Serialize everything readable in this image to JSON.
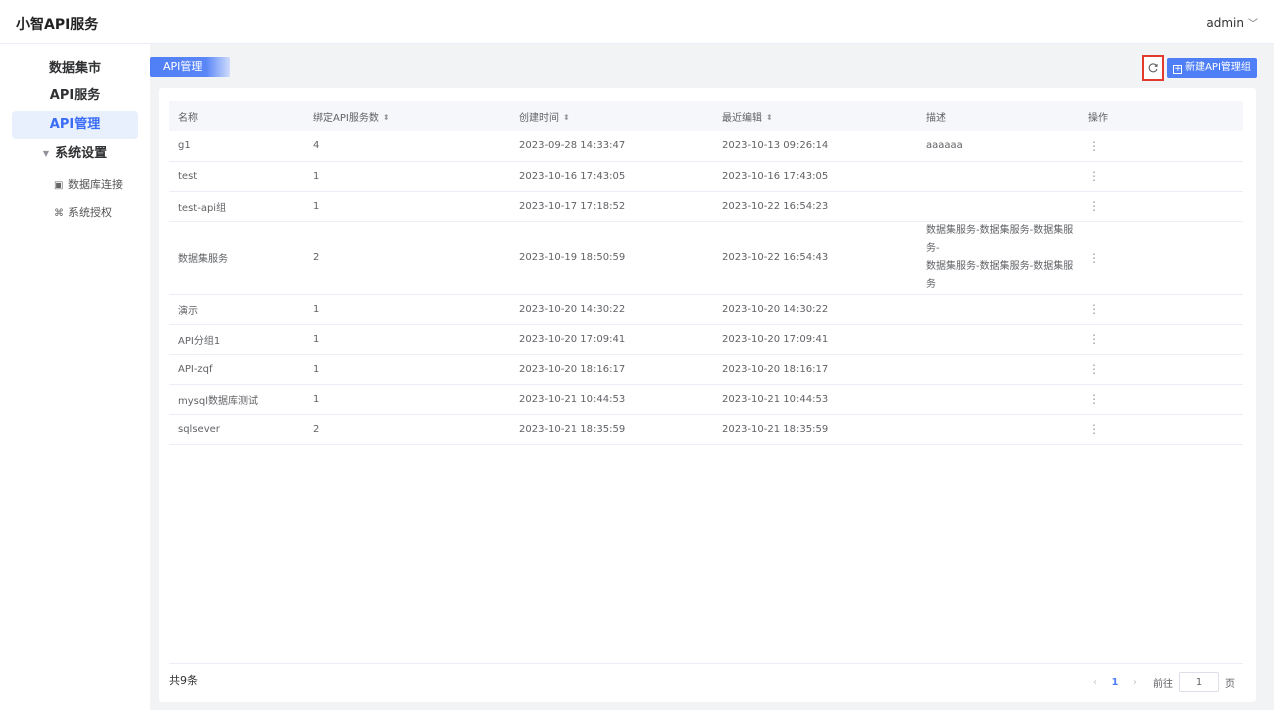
{
  "header": {
    "app_title": "小智API服务",
    "user": "admin"
  },
  "sidebar": {
    "items": [
      {
        "label": "数据集市"
      },
      {
        "label": "API服务"
      },
      {
        "label": "API管理"
      }
    ],
    "group": {
      "label": "系统设置"
    },
    "sub_items": [
      {
        "label": "数据库连接",
        "icon": "database-icon"
      },
      {
        "label": "系统授权",
        "icon": "auth-icon"
      }
    ]
  },
  "breadcrumb": {
    "label": "API管理"
  },
  "toolbar": {
    "new_label": "新建API管理组",
    "refresh_icon": "refresh-icon"
  },
  "table": {
    "columns": [
      "名称",
      "绑定API服务数",
      "创建时间",
      "最近编辑",
      "描述",
      "操作"
    ],
    "rows": [
      {
        "name": "g1",
        "count": "4",
        "created": "2023-09-28 14:33:47",
        "edited": "2023-10-13 09:26:14",
        "desc": "aaaaaa"
      },
      {
        "name": "test",
        "count": "1",
        "created": "2023-10-16 17:43:05",
        "edited": "2023-10-16 17:43:05",
        "desc": ""
      },
      {
        "name": "test-api组",
        "count": "1",
        "created": "2023-10-17 17:18:52",
        "edited": "2023-10-22 16:54:23",
        "desc": ""
      },
      {
        "name": "数据集服务",
        "count": "2",
        "created": "2023-10-19 18:50:59",
        "edited": "2023-10-22 16:54:43",
        "desc": "数据集服务-数据集服务-数据集服务-",
        "desc2": "数据集服务-数据集服务-数据集服务"
      },
      {
        "name": "演示",
        "count": "1",
        "created": "2023-10-20 14:30:22",
        "edited": "2023-10-20 14:30:22",
        "desc": ""
      },
      {
        "name": "API分组1",
        "count": "1",
        "created": "2023-10-20 17:09:41",
        "edited": "2023-10-20 17:09:41",
        "desc": ""
      },
      {
        "name": "API-zqf",
        "count": "1",
        "created": "2023-10-20 18:16:17",
        "edited": "2023-10-20 18:16:17",
        "desc": ""
      },
      {
        "name": "mysql数据库测试",
        "count": "1",
        "created": "2023-10-21 10:44:53",
        "edited": "2023-10-21 10:44:53",
        "desc": ""
      },
      {
        "name": "sqlsever",
        "count": "2",
        "created": "2023-10-21 18:35:59",
        "edited": "2023-10-21 18:35:59",
        "desc": ""
      }
    ],
    "op_glyph": "⋮"
  },
  "footer": {
    "total": "共9条",
    "current_page": "1",
    "goto_label": "前往",
    "goto_value": "1",
    "page_suffix": "页"
  },
  "colors": {
    "accent": "#4f7ff6",
    "highlight_border": "#e23b2e"
  }
}
